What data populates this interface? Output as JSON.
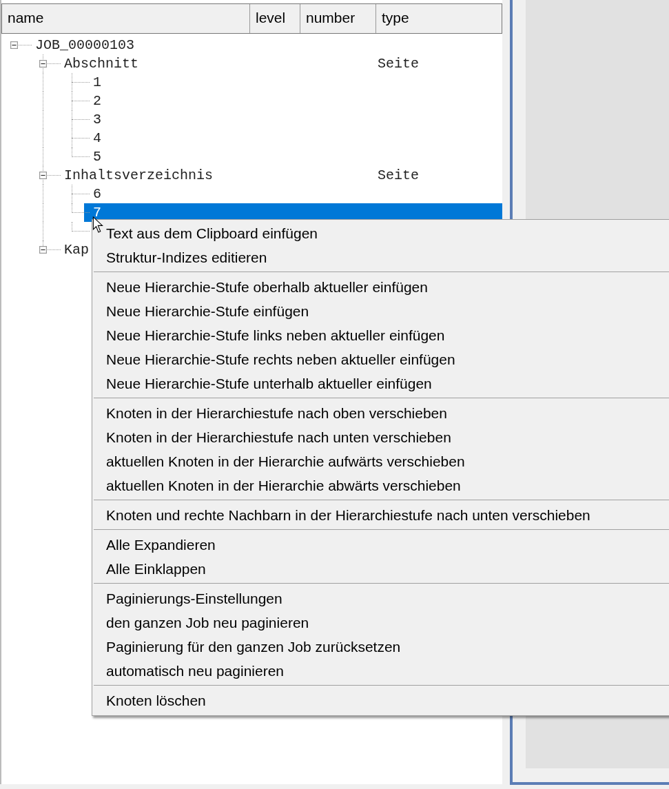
{
  "table": {
    "columns": [
      "name",
      "level",
      "number",
      "type"
    ],
    "tree": [
      {
        "name": "JOB_00000103",
        "expanded": true,
        "selected": false,
        "children": [
          {
            "name": "Abschnitt",
            "type": "Seite",
            "expanded": true,
            "selected": false,
            "children": [
              {
                "name": "1",
                "selected": false
              },
              {
                "name": "2",
                "selected": false
              },
              {
                "name": "3",
                "selected": false
              },
              {
                "name": "4",
                "selected": false
              },
              {
                "name": "5",
                "selected": false
              }
            ]
          },
          {
            "name": "Inhaltsverzeichnis",
            "type": "Seite",
            "expanded": true,
            "selected": false,
            "children": [
              {
                "name": "6",
                "selected": false
              },
              {
                "name": "7",
                "selected": true
              }
            ]
          },
          {
            "name": "Kap",
            "expanded": true,
            "selected": false
          }
        ]
      }
    ]
  },
  "context_menu": {
    "groups": [
      [
        "Text aus dem Clipboard einfügen",
        "Struktur-Indizes editieren"
      ],
      [
        "Neue Hierarchie-Stufe oberhalb aktueller einfügen",
        "Neue Hierarchie-Stufe einfügen",
        "Neue Hierarchie-Stufe links neben aktueller einfügen",
        "Neue Hierarchie-Stufe rechts neben aktueller einfügen",
        "Neue Hierarchie-Stufe unterhalb aktueller einfügen"
      ],
      [
        "Knoten in der Hierarchiestufe nach oben verschieben",
        "Knoten in der Hierarchiestufe nach unten verschieben",
        "aktuellen Knoten in der Hierarchie aufwärts verschieben",
        "aktuellen Knoten in der Hierarchie abwärts verschieben"
      ],
      [
        "Knoten und rechte Nachbarn in der Hierarchiestufe nach unten verschieben"
      ],
      [
        "Alle Expandieren",
        "Alle Einklappen"
      ],
      [
        "Paginierungs-Einstellungen",
        "den ganzen Job neu paginieren",
        "Paginierung für den ganzen Job zurücksetzen",
        "automatisch neu paginieren"
      ],
      [
        "Knoten löschen"
      ]
    ]
  }
}
